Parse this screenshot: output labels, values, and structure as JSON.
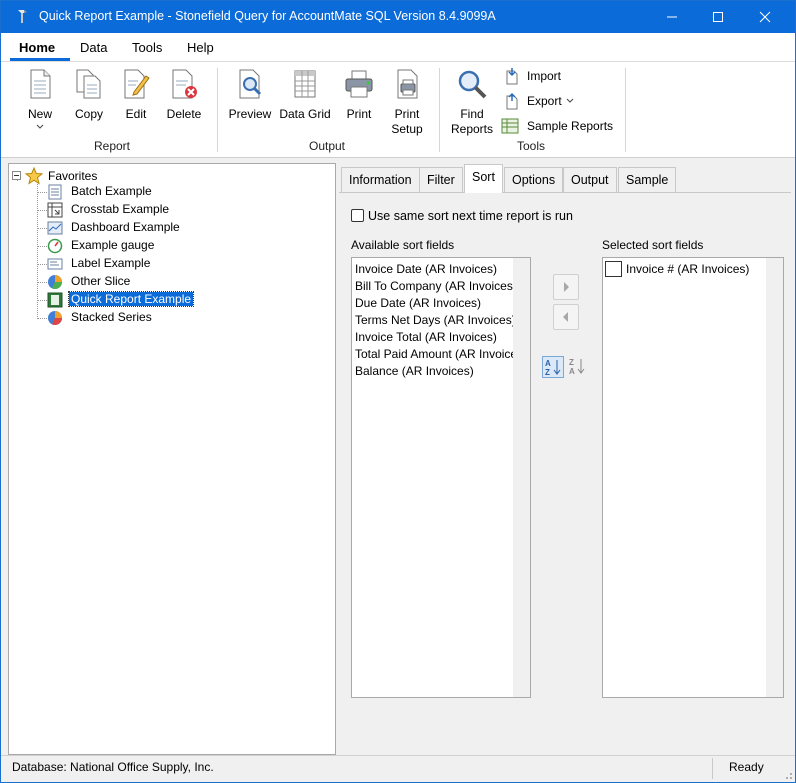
{
  "window": {
    "title": "Quick Report Example - Stonefield Query for AccountMate SQL Version 8.4.9099A"
  },
  "menu": {
    "items": [
      "Home",
      "Data",
      "Tools",
      "Help"
    ]
  },
  "ribbon": {
    "report_group": {
      "label": "Report",
      "buttons": [
        "New",
        "Copy",
        "Edit",
        "Delete"
      ]
    },
    "output_group": {
      "label": "Output",
      "buttons": [
        "Preview",
        "Data Grid",
        "Print",
        "Print",
        "Setup"
      ]
    },
    "tools_group": {
      "label": "Tools",
      "find_reports": [
        "Find",
        "Reports"
      ],
      "small_buttons": [
        "Import",
        "Export",
        "Sample Reports"
      ]
    }
  },
  "tree": {
    "root": "Favorites",
    "items": [
      "Batch Example",
      "Crosstab Example",
      "Dashboard Example",
      "Example gauge",
      "Label Example",
      "Other Slice",
      "Quick Report Example",
      "Stacked Series"
    ],
    "selected_index": 6
  },
  "tabs": {
    "items": [
      "Information",
      "Filter",
      "Sort",
      "Options",
      "Output",
      "Sample"
    ],
    "active": "Sort"
  },
  "sort": {
    "checkbox_label": "Use same sort next time report is run",
    "available_label": "Available sort fields",
    "selected_label": "Selected sort fields",
    "available": [
      "Invoice Date (AR Invoices)",
      "Bill To Company (AR Invoices)",
      "Due Date (AR Invoices)",
      "Terms Net Days (AR Invoices)",
      "Invoice Total (AR Invoices)",
      "Total Paid Amount (AR Invoices)",
      "Balance (AR Invoices)"
    ],
    "selected": [
      "Invoice # (AR Invoices)"
    ]
  },
  "status": {
    "database": "Database: National Office Supply, Inc.",
    "state": "Ready"
  },
  "colors": {
    "accent": "#0b6bd8",
    "selection": "#0b6bd8"
  }
}
